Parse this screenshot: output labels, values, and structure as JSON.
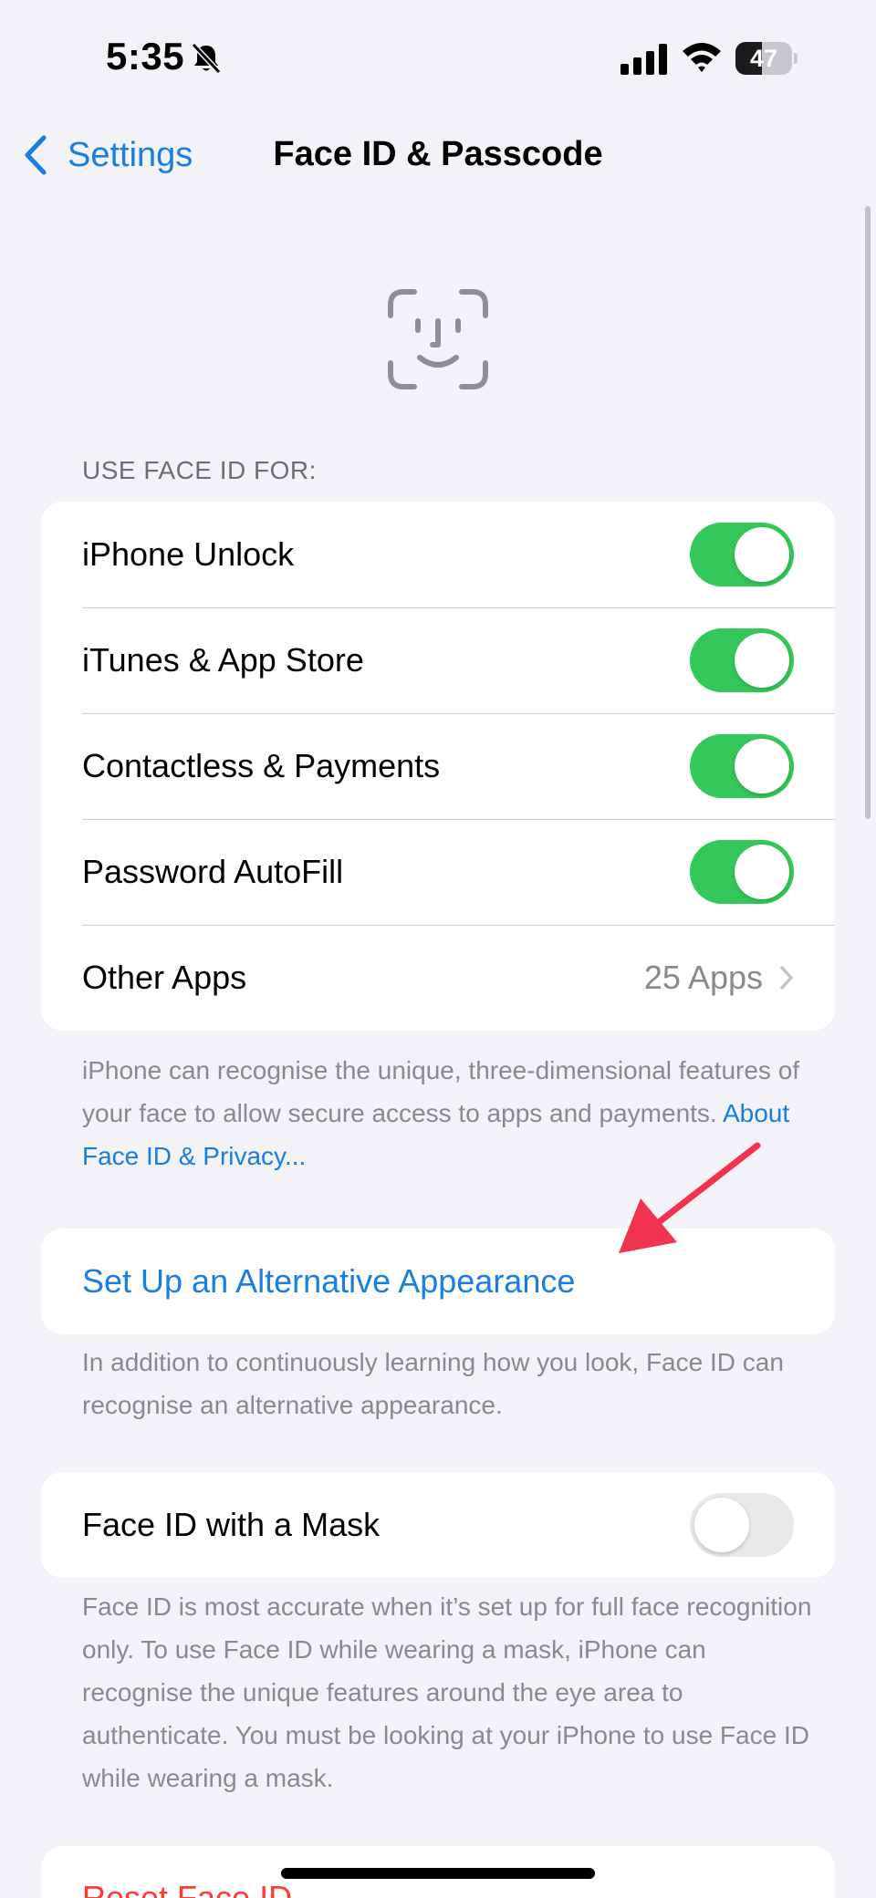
{
  "status_bar": {
    "time": "5:35",
    "battery_level": "47",
    "battery_fraction": 0.47,
    "silent_icon": "bell-slash-icon",
    "signal_icon": "cellular-signal-icon",
    "wifi_icon": "wifi-icon"
  },
  "nav": {
    "back_label": "Settings",
    "title": "Face ID & Passcode"
  },
  "hero_icon": "face-id-icon",
  "use_face_id": {
    "header": "USE FACE ID FOR:",
    "items": [
      {
        "label": "iPhone Unlock",
        "enabled": true
      },
      {
        "label": "iTunes & App Store",
        "enabled": true
      },
      {
        "label": "Contactless & Payments",
        "enabled": true
      },
      {
        "label": "Password AutoFill",
        "enabled": true
      }
    ],
    "other_apps": {
      "label": "Other Apps",
      "value": "25 Apps"
    },
    "footer_text": "iPhone can recognise the unique, three-dimensional features of your face to allow secure access to apps and payments.",
    "footer_link": "About Face ID & Privacy..."
  },
  "alternative_appearance": {
    "label": "Set Up an Alternative Appearance",
    "footer_text": "In addition to continuously learning how you look, Face ID can recognise an alternative appearance."
  },
  "mask": {
    "label": "Face ID with a Mask",
    "enabled": false,
    "footer_text": "Face ID is most accurate when it’s set up for full face recognition only. To use Face ID while wearing a mask, iPhone can recognise the unique features around the eye area to authenticate. You must be looking at your iPhone to use Face ID while wearing a mask."
  },
  "reset": {
    "label": "Reset Face ID"
  },
  "colors": {
    "accent": "#1a7ee0",
    "toggle_on": "#34c759",
    "toggle_off": "#e9e9eb",
    "destructive": "#ff3b30",
    "annotation_arrow": "#f0334f",
    "background": "#f2f2f7"
  }
}
